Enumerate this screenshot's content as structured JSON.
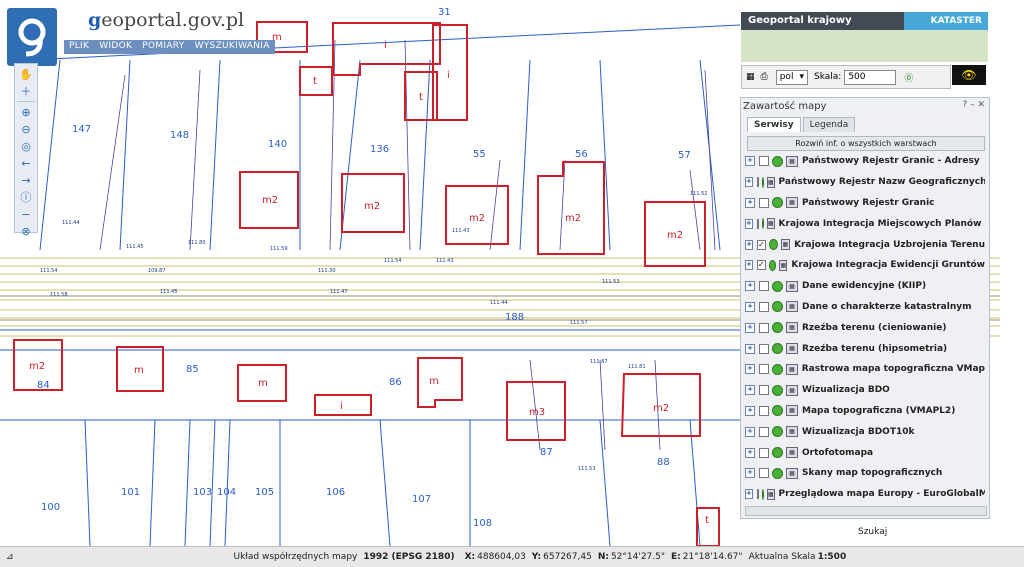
{
  "header": {
    "logo_letter": "g",
    "site_title": "eoportal.gov.pl",
    "site_title_first": "g"
  },
  "menu": [
    "PLIK",
    "WIDOK",
    "POMIARY",
    "WYSZUKIWANIA"
  ],
  "banner": {
    "left": "Geoportal krajowy",
    "right": "KATASTER"
  },
  "scale_control": {
    "language": "pol",
    "scale_label": "Skala:",
    "scale_value": "500"
  },
  "panel": {
    "title": "Zawartość mapy",
    "tabs": [
      "Serwisy",
      "Legenda"
    ],
    "expand_label": "Rozwiń inf. o wszystkich warstwach",
    "layers": [
      {
        "label": "Państwowy Rejestr Granic - Adresy",
        "checked": false
      },
      {
        "label": "Państwowy Rejestr Nazw Geograficznych",
        "checked": false
      },
      {
        "label": "Państwowy Rejestr Granic",
        "checked": false
      },
      {
        "label": "Krajowa Integracja Miejscowych Planów Zag",
        "checked": false
      },
      {
        "label": "Krajowa Integracja Uzbrojenia Terenu",
        "checked": true
      },
      {
        "label": "Krajowa Integracja Ewidencji Gruntów",
        "checked": true
      },
      {
        "label": "Dane ewidencyjne (KIIP)",
        "checked": false
      },
      {
        "label": "Dane o charakterze katastralnym",
        "checked": false
      },
      {
        "label": "Rzeźba terenu (cieniowanie)",
        "checked": false
      },
      {
        "label": "Rzeźba terenu (hipsometria)",
        "checked": false
      },
      {
        "label": "Rastrowa mapa topograficzna VMap",
        "checked": false
      },
      {
        "label": "Wizualizacja BDO",
        "checked": false
      },
      {
        "label": "Mapa topograficzna (VMAPL2)",
        "checked": false
      },
      {
        "label": "Wizualizacja BDOT10k",
        "checked": false
      },
      {
        "label": "Ortofotomapa",
        "checked": false
      },
      {
        "label": "Skany map topograficznych",
        "checked": false
      },
      {
        "label": "Przeglądowa mapa Europy - EuroGlobalMap",
        "checked": false
      }
    ]
  },
  "search_label": "Szukaj",
  "status": {
    "crs_label": "Układ współrzędnych mapy",
    "crs_value": "1992 (EPSG 2180)",
    "x_label": "X:",
    "x_value": "488604,03",
    "y_label": "Y:",
    "y_value": "657267,45",
    "n_label": "N:",
    "n_value": "52°14'27.5\"",
    "e_label": "E:",
    "e_value": "21°18'14.67\"",
    "scale_label": "Aktualna Skala",
    "scale_value": "1:500"
  },
  "map_labels": {
    "parcels": [
      "31",
      "147",
      "148",
      "140",
      "136",
      "55",
      "56",
      "57",
      "85",
      "86",
      "188",
      "101",
      "103",
      "104",
      "105",
      "106",
      "107",
      "108",
      "100",
      "87",
      "88",
      "84"
    ],
    "buildings": [
      "m",
      "i",
      "t",
      "i",
      "t",
      "m2",
      "m2",
      "m2",
      "m2",
      "m2",
      "m2",
      "m2",
      "m",
      "m",
      "m",
      "i",
      "m3",
      "m2",
      "m3",
      "t"
    ]
  },
  "colors": {
    "building": "#cc1f2a",
    "parcel": "#2a5fc6",
    "utility": "#b8b040",
    "road": "#7a6a40"
  }
}
